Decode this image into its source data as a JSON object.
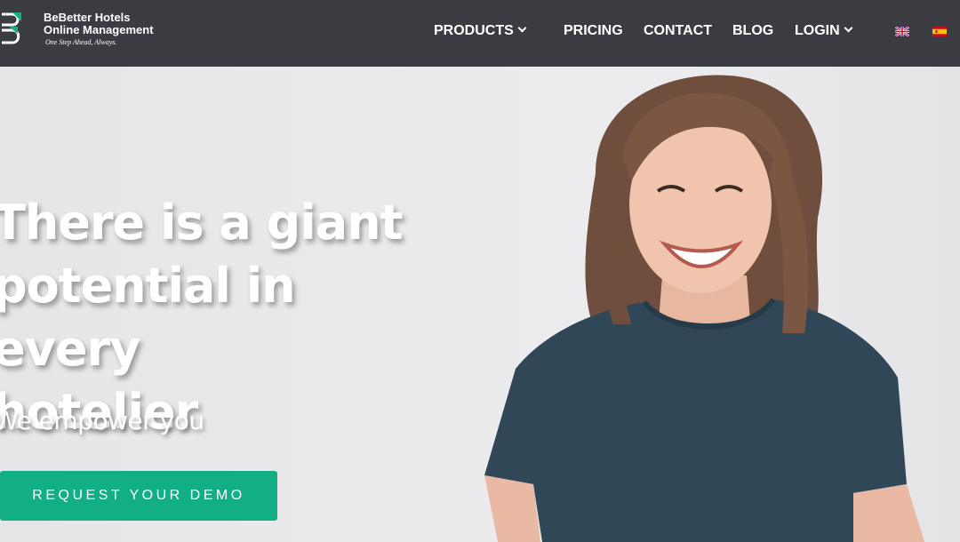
{
  "brand": {
    "name_line1": "BeBetter Hotels",
    "name_line2": "Online Management",
    "tagline": "One Step Ahead, Always.",
    "accent_color": "#12ae84"
  },
  "nav": {
    "items": [
      {
        "label": "PRODUCTS",
        "has_dropdown": true
      },
      {
        "label": "PRICING",
        "has_dropdown": false
      },
      {
        "label": "CONTACT",
        "has_dropdown": false
      },
      {
        "label": "BLOG",
        "has_dropdown": false
      },
      {
        "label": "LOGIN",
        "has_dropdown": true
      }
    ],
    "languages": [
      {
        "icon": "uk-flag-icon",
        "code": "en"
      },
      {
        "icon": "spain-flag-icon",
        "code": "es"
      }
    ]
  },
  "hero": {
    "title_lines": [
      "There is a giant",
      "potential in every",
      "hotelier"
    ],
    "subtitle": "We empower you",
    "cta_label": "REQUEST YOUR DEMO",
    "photo": "smiling-woman-photo"
  }
}
